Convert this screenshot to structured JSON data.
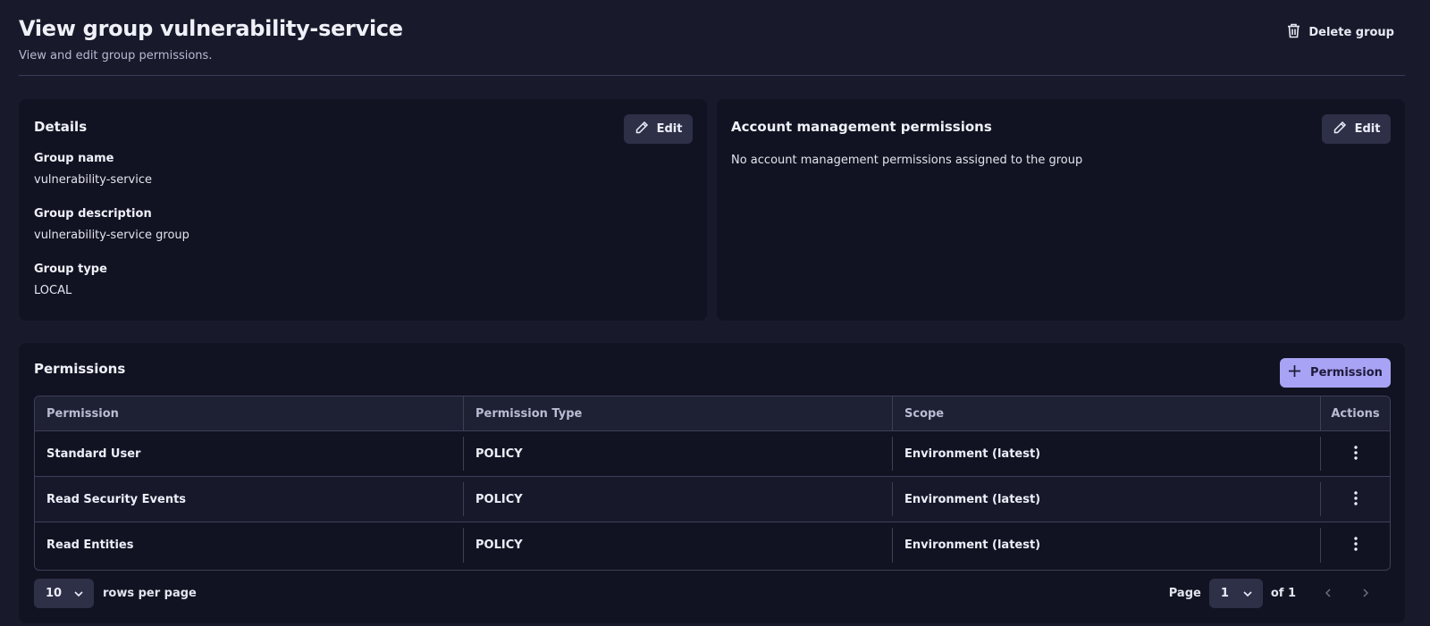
{
  "header": {
    "title": "View group vulnerability-service",
    "subtitle": "View and edit group permissions.",
    "delete_label": "Delete group"
  },
  "details": {
    "title": "Details",
    "edit_label": "Edit",
    "fields": [
      {
        "label": "Group name",
        "value": "vulnerability-service"
      },
      {
        "label": "Group description",
        "value": "vulnerability-service group"
      },
      {
        "label": "Group type",
        "value": "LOCAL"
      }
    ]
  },
  "account_mgmt": {
    "title": "Account management permissions",
    "edit_label": "Edit",
    "empty_text": "No account management permissions assigned to the group"
  },
  "permissions": {
    "title": "Permissions",
    "add_label": "Permission",
    "columns": [
      "Permission",
      "Permission Type",
      "Scope",
      "Actions"
    ],
    "rows": [
      {
        "permission": "Standard User",
        "type": "POLICY",
        "scope": "Environment (latest)"
      },
      {
        "permission": "Read Security Events",
        "type": "POLICY",
        "scope": "Environment (latest)"
      },
      {
        "permission": "Read Entities",
        "type": "POLICY",
        "scope": "Environment (latest)"
      }
    ],
    "pagination": {
      "rows_per_page": "10",
      "rows_per_page_label": "rows per page",
      "page_label": "Page",
      "current_page": "1",
      "of_label": "of 1"
    }
  },
  "icons": {
    "delete": "trash-icon",
    "edit": "pencil-icon",
    "add": "plus-icon",
    "actions": "kebab-icon",
    "dropdown": "chevron-down-icon",
    "prev": "chevron-left-icon",
    "next": "chevron-right-icon"
  },
  "colors": {
    "background": "#181a2c",
    "card": "#121322",
    "primary_button": "#a9a3f5",
    "secondary_button": "#2e3048"
  }
}
